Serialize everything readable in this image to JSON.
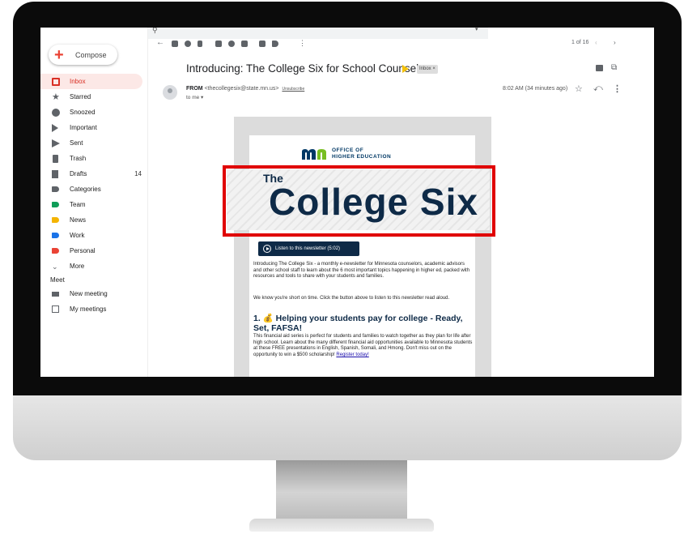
{
  "sidebar": {
    "compose_label": "Compose",
    "items": [
      {
        "label": "Inbox",
        "count": ""
      },
      {
        "label": "Starred",
        "count": ""
      },
      {
        "label": "Snoozed",
        "count": ""
      },
      {
        "label": "Important",
        "count": ""
      },
      {
        "label": "Sent",
        "count": ""
      },
      {
        "label": "Trash",
        "count": ""
      },
      {
        "label": "Drafts",
        "count": "14"
      },
      {
        "label": "Categories",
        "count": ""
      },
      {
        "label": "Team",
        "count": ""
      },
      {
        "label": "News",
        "count": ""
      },
      {
        "label": "Work",
        "count": ""
      },
      {
        "label": "Personal",
        "count": ""
      },
      {
        "label": "More",
        "count": ""
      }
    ],
    "label_colors": {
      "team": "#0f9d58",
      "news": "#f4b400",
      "work": "#1a73e8",
      "personal": "#ea4335"
    },
    "meet_header": "Meet",
    "meet_items": [
      "New meeting",
      "My meetings"
    ]
  },
  "toolbar": {
    "pager": "1 of 16"
  },
  "email": {
    "subject": "Introducing: The College Six for School Counselors",
    "label_chip": "Inbox ×",
    "from_label": "FROM",
    "from_address": "<thecollegesix@state.mn.us>",
    "unsubscribe": "Unsubscribe",
    "to": "to me ▾",
    "timestamp": "8:02 AM (34 minutes ago)"
  },
  "newsletter": {
    "org_line1": "OFFICE OF",
    "org_line2": "HIGHER EDUCATION",
    "banner_small": "The",
    "banner_title": "College Six",
    "listen_label": "Listen to this newsletter (5:02)",
    "intro": "Introducing The College Six - a monthly e-newsletter for Minnesota counselors, academic advisors and other school staff to learn about the 6 most important topics happening in higher ed, packed with resources and tools to share with your students and families.",
    "note": "We know you're short on time. Click the button above to listen to this newsletter read aloud.",
    "section_heading": "1. 💰 Helping your students pay for college - Ready, Set, FAFSA!",
    "section_body": "This financial aid series is perfect for students and families to watch together as they plan for life after high school. Learn about the many different financial aid opportunities available to Minnesota students at these FREE presentations in English, Spanish, Somali, and Hmong. Don't miss out on the opportunity to win a $500 scholarship!",
    "register_link": "Register today!",
    "brand_color": "#0e2a47",
    "highlight_color": "#e00000"
  }
}
